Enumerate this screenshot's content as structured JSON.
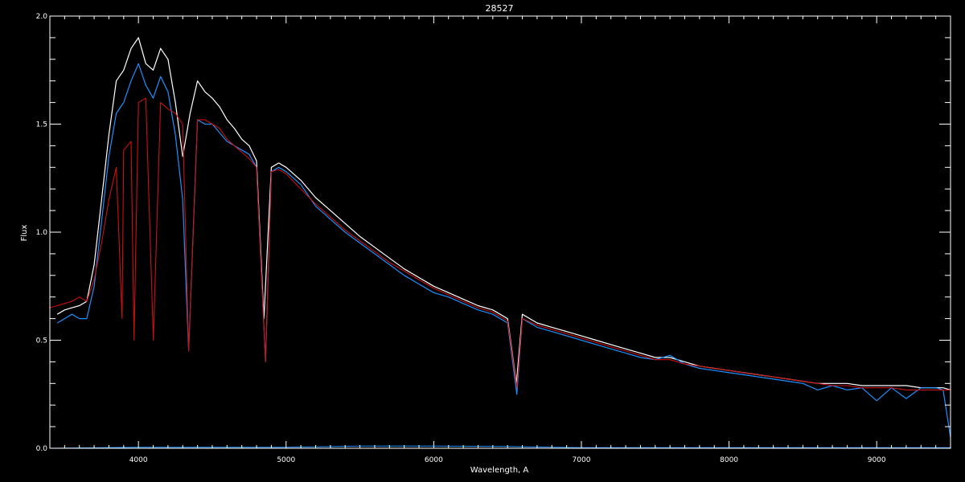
{
  "chart_data": {
    "type": "line",
    "title": "28527",
    "xlabel": "Wavelength, A",
    "ylabel": "Flux",
    "xlim": [
      3400,
      9500
    ],
    "ylim": [
      0.0,
      2.0
    ],
    "x_ticks": [
      4000,
      5000,
      6000,
      7000,
      8000,
      9000
    ],
    "x_tick_labels": [
      "4000",
      "5000",
      "6000",
      "7000",
      "8000",
      "9000"
    ],
    "y_ticks": [
      0.0,
      0.5,
      1.0,
      1.5,
      2.0
    ],
    "y_tick_labels": [
      "0.0",
      "0.5",
      "1.0",
      "1.5",
      "2.0"
    ],
    "x_minor_step": 100,
    "y_minor_step": 0.1,
    "grid": false,
    "legend": "none",
    "colors": {
      "background": "#000000",
      "axes": "#ffffff",
      "observed": "#ffffff",
      "observed_blue": "#1e90ff",
      "model": "#cc1111",
      "error": "#1e90ff"
    },
    "series": [
      {
        "key": "observed_white",
        "x": [
          3450,
          3500,
          3550,
          3600,
          3650,
          3700,
          3750,
          3800,
          3850,
          3900,
          3950,
          4000,
          4050,
          4100,
          4150,
          4200,
          4250,
          4300,
          4350,
          4400,
          4450,
          4500,
          4550,
          4600,
          4650,
          4700,
          4750,
          4800,
          4850,
          4900,
          4950,
          5000,
          5100,
          5200,
          5300,
          5400,
          5500,
          5600,
          5700,
          5800,
          5900,
          6000,
          6100,
          6200,
          6300,
          6400,
          6500,
          6560,
          6600,
          6700,
          6800,
          6900,
          7000,
          7100,
          7200,
          7300,
          7400,
          7500,
          7600,
          7700,
          7800,
          7900,
          8000,
          8100,
          8200,
          8300,
          8400,
          8500,
          8600,
          8700,
          8800,
          8900,
          9000,
          9100,
          9200,
          9300,
          9400,
          9450,
          9500
        ],
        "y": [
          0.62,
          0.64,
          0.65,
          0.66,
          0.68,
          0.85,
          1.15,
          1.45,
          1.7,
          1.75,
          1.85,
          1.9,
          1.78,
          1.75,
          1.85,
          1.8,
          1.6,
          1.35,
          1.55,
          1.7,
          1.65,
          1.62,
          1.58,
          1.52,
          1.48,
          1.43,
          1.4,
          1.33,
          0.6,
          1.3,
          1.32,
          1.3,
          1.24,
          1.16,
          1.1,
          1.04,
          0.98,
          0.93,
          0.88,
          0.83,
          0.79,
          0.75,
          0.72,
          0.69,
          0.66,
          0.64,
          0.6,
          0.3,
          0.62,
          0.58,
          0.56,
          0.54,
          0.52,
          0.5,
          0.48,
          0.46,
          0.44,
          0.42,
          0.42,
          0.4,
          0.38,
          0.37,
          0.36,
          0.35,
          0.34,
          0.33,
          0.32,
          0.31,
          0.3,
          0.3,
          0.3,
          0.29,
          0.29,
          0.29,
          0.29,
          0.28,
          0.28,
          0.28,
          0.27
        ]
      },
      {
        "key": "observed_blue",
        "x": [
          3450,
          3500,
          3550,
          3600,
          3650,
          3700,
          3750,
          3800,
          3850,
          3900,
          3950,
          4000,
          4050,
          4100,
          4150,
          4200,
          4250,
          4300,
          4340,
          4400,
          4450,
          4500,
          4550,
          4600,
          4650,
          4700,
          4750,
          4800,
          4861,
          4900,
          4950,
          5000,
          5100,
          5200,
          5300,
          5400,
          5500,
          5600,
          5700,
          5800,
          5900,
          6000,
          6100,
          6200,
          6300,
          6400,
          6500,
          6563,
          6600,
          6700,
          6800,
          6900,
          7000,
          7100,
          7200,
          7300,
          7400,
          7500,
          7600,
          7700,
          7800,
          7900,
          8000,
          8100,
          8200,
          8300,
          8400,
          8500,
          8600,
          8700,
          8800,
          8900,
          9000,
          9100,
          9200,
          9300,
          9400,
          9450,
          9500
        ],
        "y": [
          0.58,
          0.6,
          0.62,
          0.6,
          0.6,
          0.75,
          1.05,
          1.35,
          1.55,
          1.6,
          1.7,
          1.78,
          1.68,
          1.62,
          1.72,
          1.65,
          1.45,
          1.15,
          0.45,
          1.52,
          1.5,
          1.5,
          1.46,
          1.42,
          1.4,
          1.38,
          1.36,
          1.3,
          0.4,
          1.28,
          1.3,
          1.28,
          1.22,
          1.12,
          1.06,
          1.0,
          0.95,
          0.9,
          0.85,
          0.8,
          0.76,
          0.72,
          0.7,
          0.67,
          0.64,
          0.62,
          0.58,
          0.25,
          0.6,
          0.56,
          0.54,
          0.52,
          0.5,
          0.48,
          0.46,
          0.44,
          0.42,
          0.41,
          0.43,
          0.39,
          0.37,
          0.36,
          0.35,
          0.34,
          0.33,
          0.32,
          0.31,
          0.3,
          0.27,
          0.29,
          0.27,
          0.28,
          0.22,
          0.28,
          0.23,
          0.28,
          0.28,
          0.27,
          0.05
        ]
      },
      {
        "key": "model_red",
        "x": [
          3400,
          3450,
          3500,
          3550,
          3600,
          3650,
          3700,
          3750,
          3800,
          3850,
          3889,
          3900,
          3950,
          3970,
          4000,
          4050,
          4101,
          4150,
          4200,
          4250,
          4300,
          4340,
          4400,
          4450,
          4500,
          4550,
          4600,
          4650,
          4700,
          4750,
          4800,
          4861,
          4900,
          4950,
          5000,
          5100,
          5200,
          5300,
          5400,
          5500,
          5600,
          5700,
          5800,
          5900,
          6000,
          6100,
          6200,
          6300,
          6400,
          6500,
          6563,
          6600,
          6700,
          6800,
          6900,
          7000,
          7100,
          7200,
          7300,
          7400,
          7500,
          7600,
          7700,
          7800,
          7900,
          8000,
          8100,
          8200,
          8300,
          8400,
          8500,
          8600,
          8700,
          8800,
          8900,
          9000,
          9100,
          9200,
          9300,
          9400,
          9500
        ],
        "y": [
          0.65,
          0.66,
          0.67,
          0.68,
          0.7,
          0.68,
          0.78,
          0.95,
          1.15,
          1.3,
          0.6,
          1.38,
          1.42,
          0.5,
          1.6,
          1.62,
          0.5,
          1.6,
          1.57,
          1.55,
          1.5,
          0.45,
          1.52,
          1.52,
          1.5,
          1.48,
          1.43,
          1.4,
          1.37,
          1.34,
          1.3,
          0.4,
          1.28,
          1.29,
          1.27,
          1.2,
          1.13,
          1.07,
          1.01,
          0.96,
          0.91,
          0.86,
          0.82,
          0.78,
          0.74,
          0.71,
          0.68,
          0.65,
          0.63,
          0.59,
          0.28,
          0.6,
          0.57,
          0.55,
          0.53,
          0.51,
          0.49,
          0.47,
          0.45,
          0.43,
          0.41,
          0.41,
          0.39,
          0.38,
          0.37,
          0.36,
          0.35,
          0.34,
          0.33,
          0.32,
          0.31,
          0.3,
          0.29,
          0.29,
          0.28,
          0.28,
          0.28,
          0.27,
          0.27,
          0.27,
          0.27
        ]
      },
      {
        "key": "error_blue",
        "x": [
          3400,
          4000,
          5000,
          5500,
          6000,
          6500,
          7000,
          8000,
          9000,
          9500
        ],
        "y": [
          0.0,
          0.005,
          0.005,
          0.01,
          0.01,
          0.008,
          0.003,
          0.003,
          0.003,
          0.003
        ]
      }
    ]
  }
}
